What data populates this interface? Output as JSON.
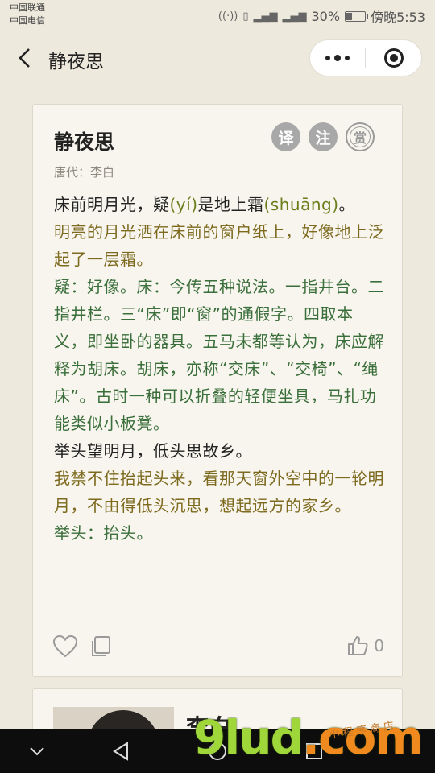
{
  "status_bar": {
    "carrier1": "中国联通",
    "carrier2": "中国电信",
    "battery_pct": "30%",
    "battery_level": 0.3,
    "time": "傍晚5:53"
  },
  "nav": {
    "title": "静夜思"
  },
  "poem": {
    "title": "静夜思",
    "author": "唐代：李白",
    "buttons": [
      "译",
      "注",
      "赏"
    ],
    "lines": [
      {
        "kind": "orig",
        "parts": [
          "床前明月光，疑",
          "(yí)",
          "是地上霜",
          "(shuāng)",
          "。"
        ]
      },
      {
        "kind": "trans",
        "text": "明亮的月光洒在床前的窗户纸上，好像地上泛起了一层霜。"
      },
      {
        "kind": "note",
        "text": "疑：好像。床：今传五种说法。一指井台。二指井栏。三“床”即“窗”的通假字。四取本义，即坐卧的器具。五马未都等认为，床应解释为胡床。胡床，亦称“交床”、“交椅”、“绳床”。古时一种可以折叠的轻便坐具，马扎功能类似小板凳。"
      },
      {
        "kind": "orig2",
        "text": "举头望明月，低头思故乡。"
      },
      {
        "kind": "trans",
        "text": "我禁不住抬起头来，看那天窗外空中的一轮明月，不由得低头沉思，想起远方的家乡。"
      },
      {
        "kind": "note",
        "text": "举头：抬头。"
      }
    ],
    "like_count": "0"
  },
  "next_card": {
    "name": "李白"
  },
  "watermark": {
    "main": "9lud",
    "suffix": ".com",
    "small": "小程序商店"
  }
}
